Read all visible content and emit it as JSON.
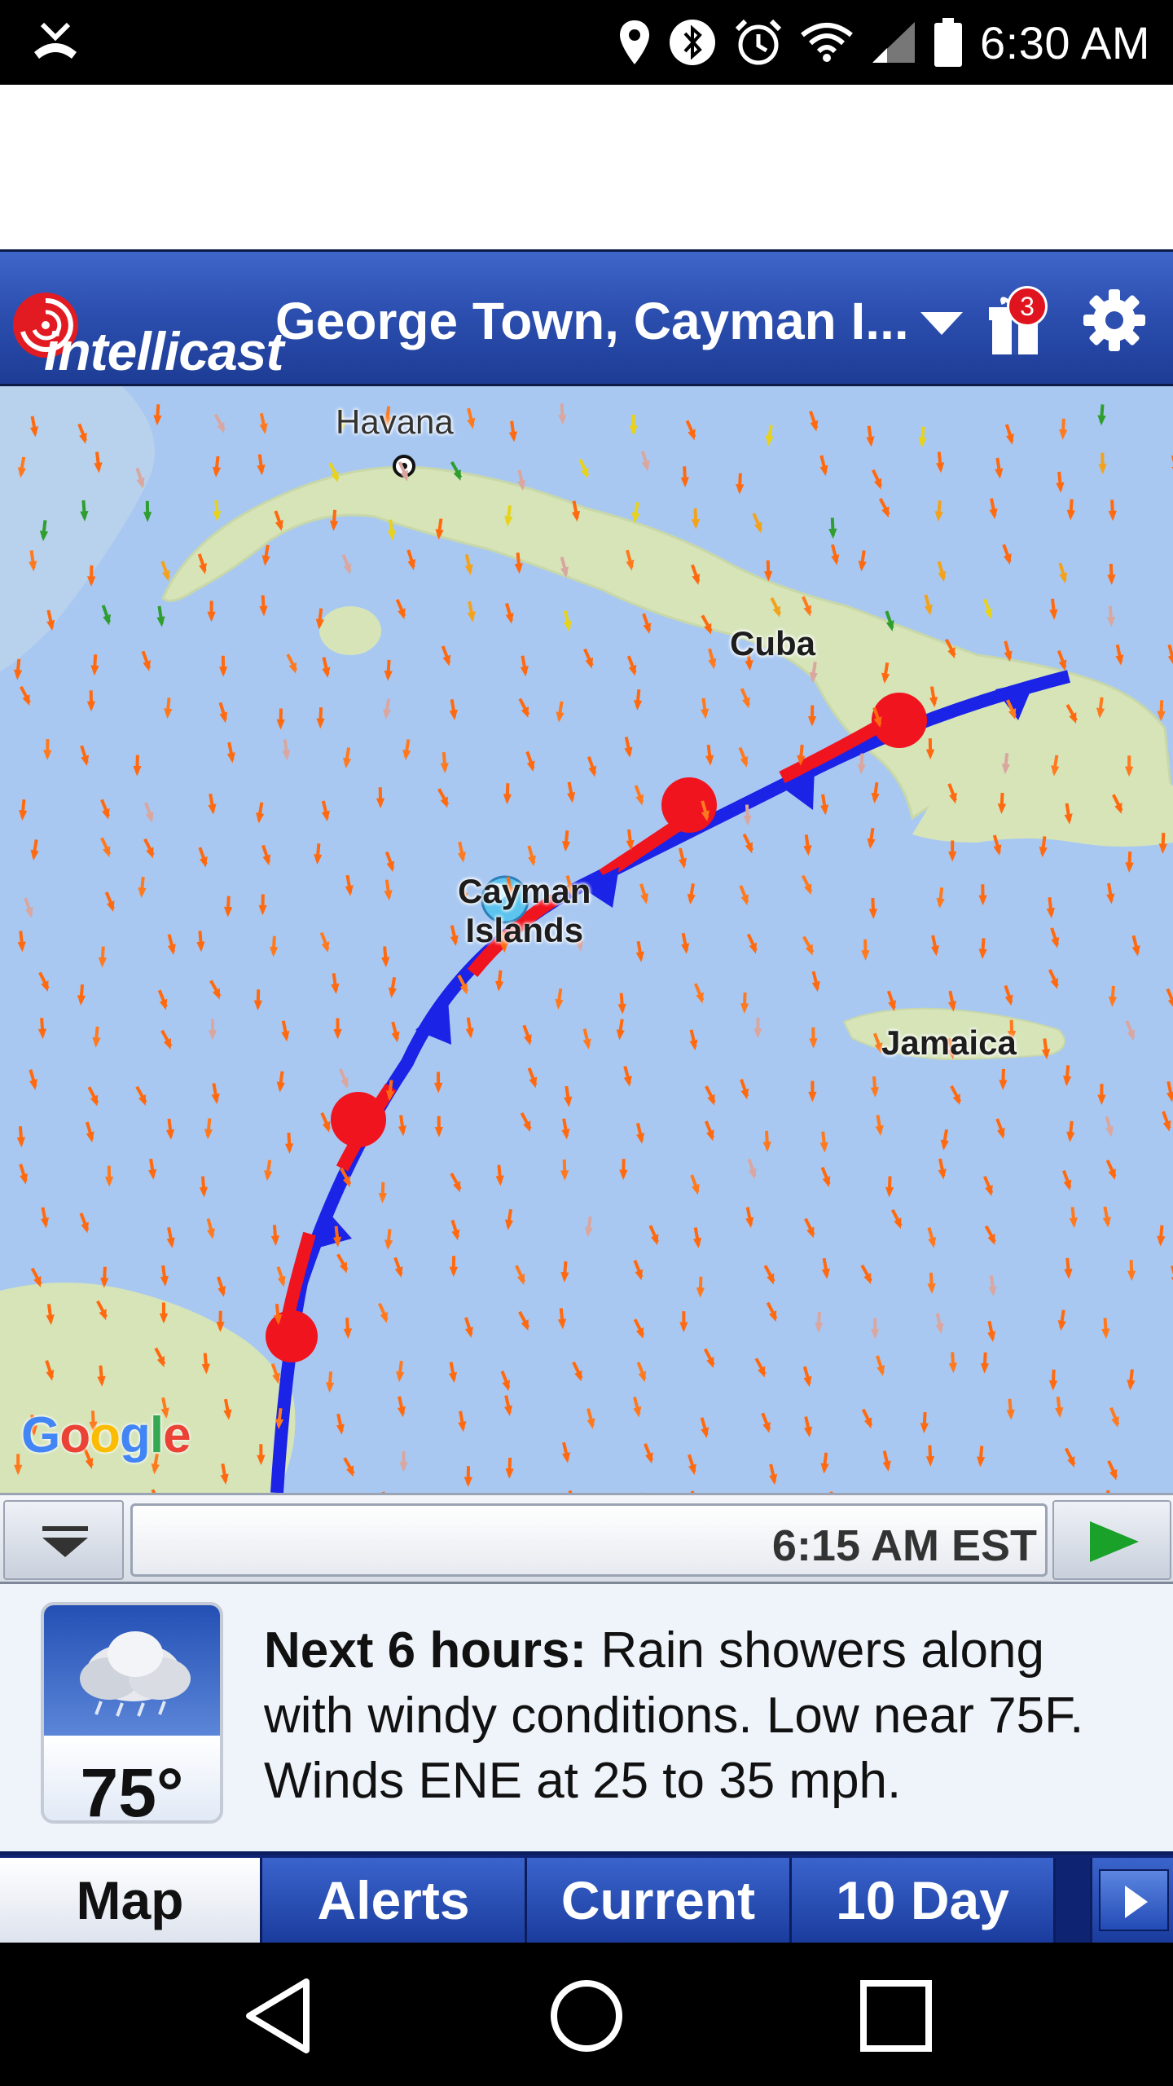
{
  "status_bar": {
    "time": "6:30 AM",
    "icons": [
      "missed-call-icon",
      "location-icon",
      "bluetooth-icon",
      "alarm-icon",
      "wifi-icon",
      "signal-icon",
      "battery-icon"
    ]
  },
  "header": {
    "logo_text": "intellicast",
    "location": "George Town, Cayman I...",
    "notification_count": "3"
  },
  "map": {
    "labels": {
      "havana": "Havana",
      "cuba": "Cuba",
      "cayman_line1": "Cayman",
      "cayman_line2": "Islands",
      "jamaica": "Jamaica"
    },
    "attribution": "Google",
    "colors": {
      "water": "#a8c8f2",
      "land": "#d6e4b8",
      "warm_front": "#f0141e",
      "cold_front": "#1a23e6",
      "wind_arrows": "#ff6a10"
    }
  },
  "timeline": {
    "time": "6:15 AM EST"
  },
  "forecast": {
    "temperature": "75°",
    "heading": "Next 6 hours:",
    "text": "Rain showers along with windy conditions. Low near 75F. Winds ENE at 25 to 35 mph."
  },
  "tabs": [
    {
      "label": "Map",
      "active": true
    },
    {
      "label": "Alerts",
      "active": false
    },
    {
      "label": "Current",
      "active": false
    },
    {
      "label": "10 Day",
      "active": false
    }
  ]
}
